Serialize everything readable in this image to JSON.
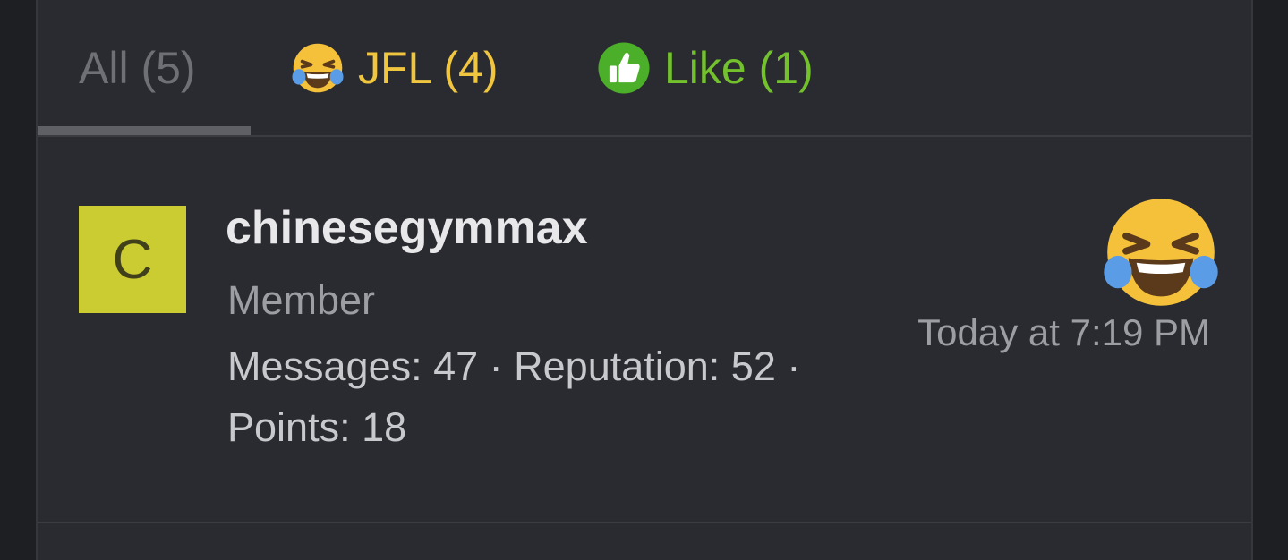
{
  "tabs": [
    {
      "label": "All (5)",
      "icon": "none",
      "color": "#6f7076",
      "active": true
    },
    {
      "label": "JFL (4)",
      "icon": "joy-face-icon",
      "color": "#f0c640",
      "active": false
    },
    {
      "label": "Like (1)",
      "icon": "thumbs-up-icon",
      "color": "#72c12d",
      "active": false
    }
  ],
  "reaction": {
    "avatar_letter": "C",
    "avatar_color": "#cbcb32",
    "username": "chinesegymmax",
    "user_title": "Member",
    "stats_line1": "Messages: 47 · Reputation: 52 ·",
    "stats_line2": "Points: 18",
    "reaction_icon": "joy-face-icon",
    "timestamp": "Today at 7:19 PM"
  }
}
